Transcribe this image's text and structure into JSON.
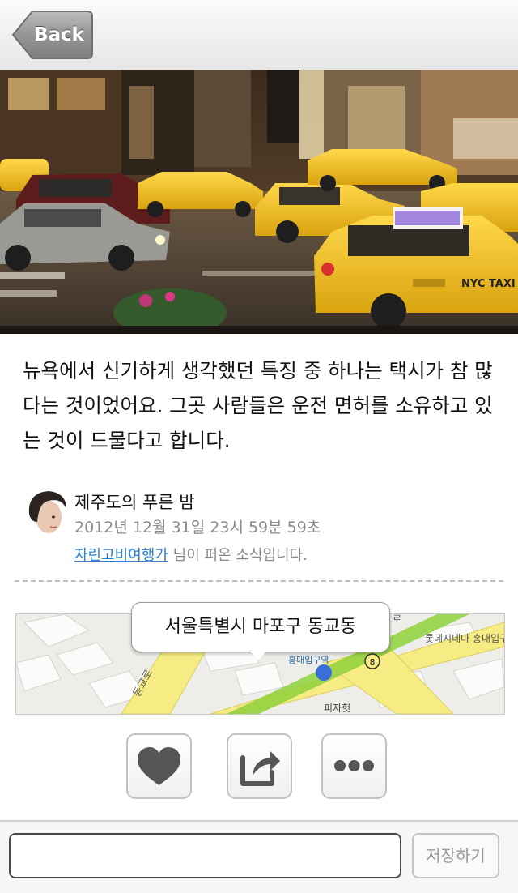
{
  "nav": {
    "back_label": "Back"
  },
  "photo": {
    "caption": "",
    "taxi_sign": "NYC TAXI"
  },
  "post": {
    "body": "뉴욕에서 신기하게 생각했던 특징 중 하나는 택시가 참 많다는 것이었어요. 그곳 사람들은 운전 면허를 소유하고 있는 것이 드물다고 합니다.",
    "author": "제주도의 푸른 밤",
    "date": "2012년 12월 31일 23시 59분 59초",
    "shared_by": "자린고비여행가",
    "shared_suffix": " 님이 퍼온 소식입니다."
  },
  "map": {
    "location_label": "서울특별시 마포구 동교동",
    "labels": {
      "station": "홍대입구역",
      "cinema": "롯데시네마\n홍대입구",
      "road": "동교로",
      "line_number": "8",
      "place": "피자헛",
      "top_right": "로"
    }
  },
  "actions": {
    "like_icon": "heart-icon",
    "share_icon": "share-icon",
    "more_icon": "more-icon"
  },
  "comment": {
    "placeholder": "",
    "save_label": "저장하기"
  },
  "colors": {
    "taxi": "#f2c21a",
    "link": "#2e7fd2",
    "subway_green": "#8fd13b",
    "road_yellow": "#f6ec83"
  }
}
